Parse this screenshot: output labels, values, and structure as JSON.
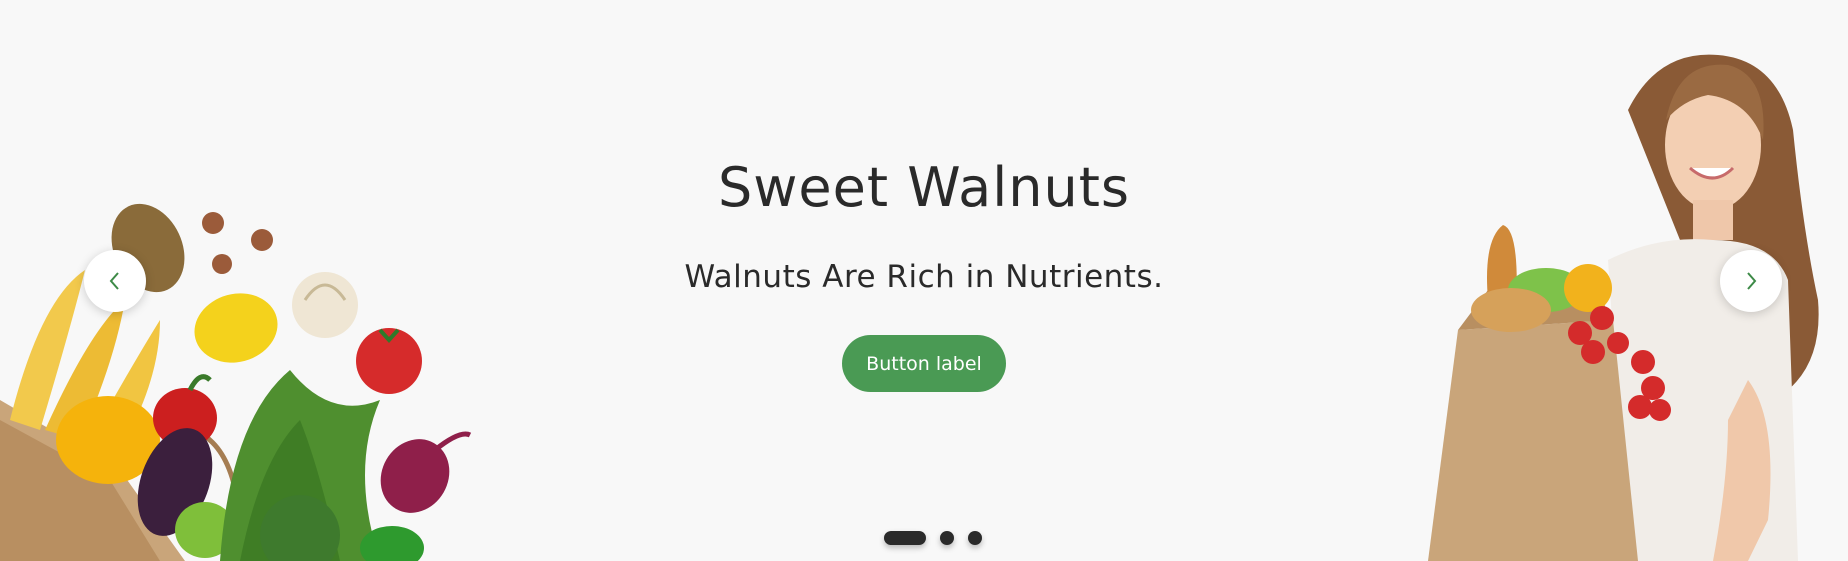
{
  "slider": {
    "title": "Sweet Walnuts",
    "subtitle": "Walnuts Are Rich in Nutrients.",
    "button_label": "Button label",
    "prev_icon": "chevron-left-icon",
    "next_icon": "chevron-right-icon",
    "slide_count": 3,
    "active_slide": 1
  },
  "colors": {
    "background": "#f8f8f8",
    "accent_button": "#4a9a54",
    "arrow_icon": "#3d8a47",
    "text": "#2a2a2a"
  }
}
